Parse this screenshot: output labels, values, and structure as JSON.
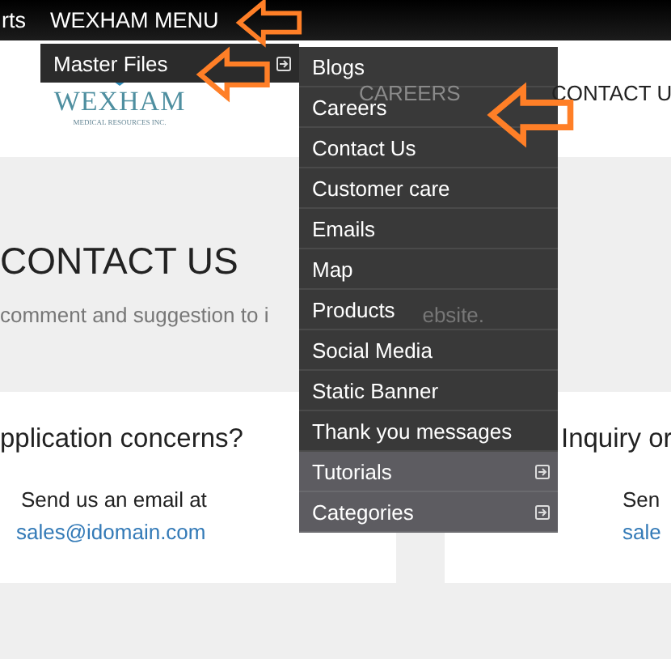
{
  "top_bar": {
    "items": [
      "rts",
      "WEXHAM MENU"
    ]
  },
  "logo": {
    "name": "WEXHAM",
    "tagline": "MEDICAL RESOURCES INC."
  },
  "nav": [
    "CAREERS",
    "CONTACT U"
  ],
  "menu": {
    "label": "Master Files",
    "has_submenu": true
  },
  "submenu": [
    {
      "label": "Blogs",
      "has_submenu": false
    },
    {
      "label": "Careers",
      "has_submenu": false
    },
    {
      "label": "Contact Us",
      "has_submenu": false
    },
    {
      "label": "Customer care",
      "has_submenu": false
    },
    {
      "label": "Emails",
      "has_submenu": false
    },
    {
      "label": "Map",
      "has_submenu": false
    },
    {
      "label": "Products",
      "has_submenu": false
    },
    {
      "label": "Social Media",
      "has_submenu": false
    },
    {
      "label": "Static Banner",
      "has_submenu": false
    },
    {
      "label": "Thank you messages",
      "has_submenu": false
    },
    {
      "label": "Tutorials",
      "has_submenu": true
    },
    {
      "label": "Categories",
      "has_submenu": true
    }
  ],
  "page": {
    "heading": "CONTACT US",
    "subtitle_parts": [
      "comment and suggestion to i",
      "ebsite."
    ]
  },
  "cards": [
    {
      "heading": "pplication concerns?",
      "text": "Send us an email at",
      "email": "sales@idomain.com"
    },
    {
      "heading": "Inquiry or",
      "text": "Sen",
      "email": "sale"
    }
  ]
}
